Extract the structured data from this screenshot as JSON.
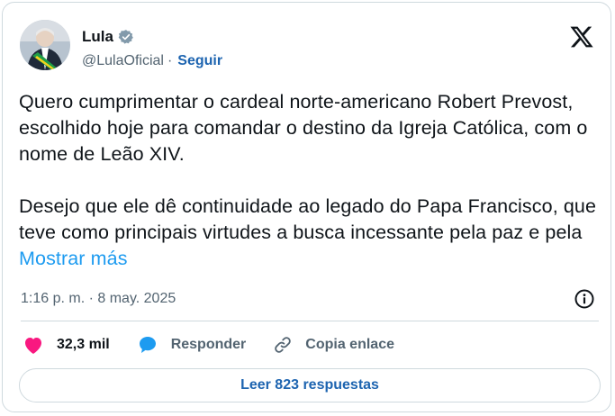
{
  "tweet": {
    "author": {
      "name": "Lula",
      "handle": "@LulaOficial",
      "separator": "·",
      "follow_label": "Seguir",
      "verified_icon": "verified-badge-icon",
      "avatar_icon": "profile-photo"
    },
    "platform_icon": "x-logo-icon",
    "paragraphs": [
      "Quero cumprimentar o cardeal norte-americano Robert Prevost, escolhido hoje para comandar o destino da Igreja Católica, com o nome de Leão XIV.",
      "Desejo que ele dê continuidade ao legado do Papa Francisco, que teve como principais virtudes a busca incessante pela paz e pela"
    ],
    "show_more_label": "Mostrar más",
    "timestamp": "1:16 p. m. · 8 may. 2025",
    "info_icon": "info-icon",
    "actions": {
      "likes_count": "32,3 mil",
      "reply_label": "Responder",
      "copy_link_label": "Copia enlace"
    },
    "read_replies_label": "Leer 823 respuestas",
    "colors": {
      "accent": "#1d9bf0",
      "link_dark": "#1d64b0",
      "like": "#f91880",
      "text": "#0f1419",
      "muted": "#536471",
      "border": "#cfd9de"
    }
  }
}
